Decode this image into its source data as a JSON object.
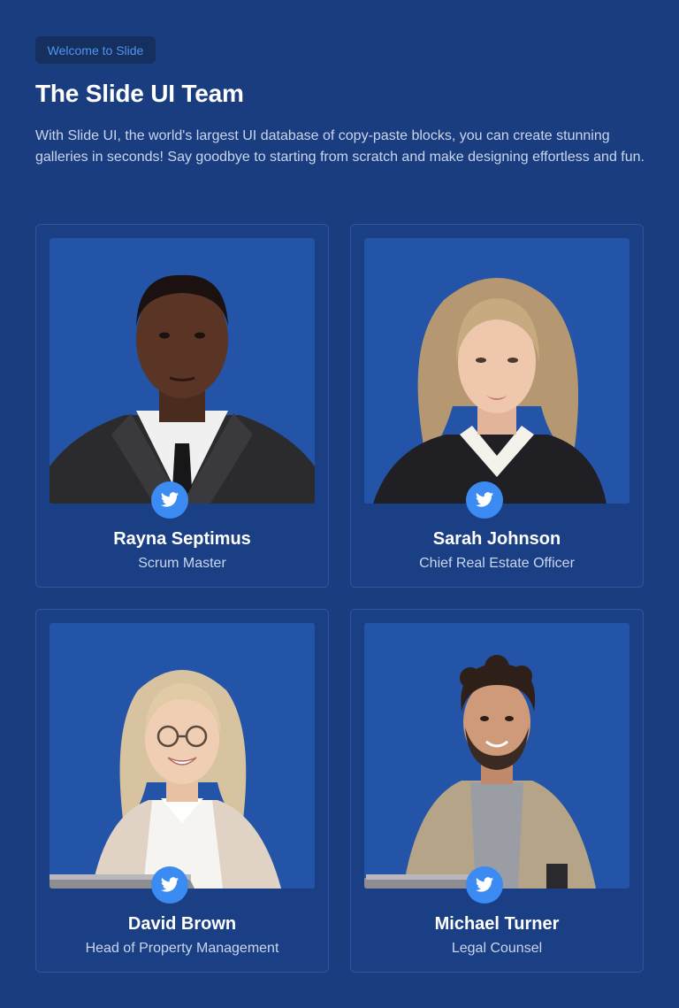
{
  "header": {
    "badge": "Welcome to Slide",
    "title": "The Slide UI Team",
    "intro": "With Slide UI, the world's largest UI database of copy-paste blocks, you can create stunning galleries in seconds! Say goodbye to starting from scratch and make designing effortless and fun."
  },
  "team": [
    {
      "name": "Rayna Septimus",
      "role": "Scrum Master",
      "social": "twitter-icon"
    },
    {
      "name": "Sarah Johnson",
      "role": "Chief Real Estate Officer",
      "social": "twitter-icon"
    },
    {
      "name": "David Brown",
      "role": "Head of Property Management",
      "social": "twitter-icon"
    },
    {
      "name": "Michael Turner",
      "role": "Legal Counsel",
      "social": "twitter-icon"
    }
  ],
  "colors": {
    "background": "#1a3d80",
    "card_photo_bg": "#2354a8",
    "accent": "#3b8bf2",
    "badge_text": "#4f95f5"
  }
}
